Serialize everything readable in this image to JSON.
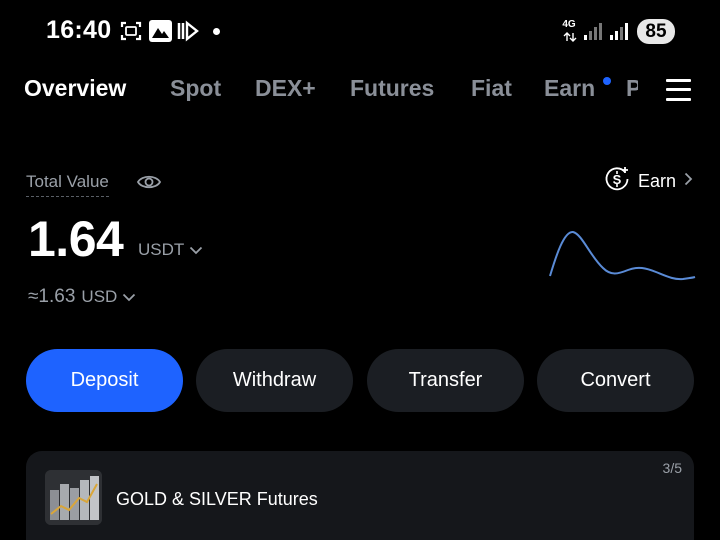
{
  "status_bar": {
    "time": "16:40",
    "network": "4G",
    "battery": "85",
    "icons": [
      "screenshot-icon",
      "gallery-icon",
      "media-icon",
      "notification-dot",
      "signal-icon",
      "signal-icon",
      "battery-icon"
    ]
  },
  "tabs": [
    {
      "label": "Overview",
      "active": true
    },
    {
      "label": "Spot",
      "active": false
    },
    {
      "label": "DEX+",
      "active": false
    },
    {
      "label": "Futures",
      "active": false
    },
    {
      "label": "Fiat",
      "active": false
    },
    {
      "label": "Earn",
      "active": false,
      "badge": true
    },
    {
      "label": "P",
      "active": false
    }
  ],
  "overview": {
    "total_value_label": "Total Value",
    "earn_label": "Earn",
    "balance": "1.64",
    "balance_currency": "USDT",
    "approx_value": "≈1.63",
    "approx_currency": "USD"
  },
  "actions": {
    "deposit": "Deposit",
    "withdraw": "Withdraw",
    "transfer": "Transfer",
    "convert": "Convert"
  },
  "promo": {
    "title": "GOLD & SILVER Futures",
    "page": "3/5"
  },
  "colors": {
    "accent": "#1e63ff",
    "background": "#000000",
    "button_bg": "#1b1e23",
    "muted_text": "#9aa0a8",
    "sparkline": "#5a8bd6"
  }
}
